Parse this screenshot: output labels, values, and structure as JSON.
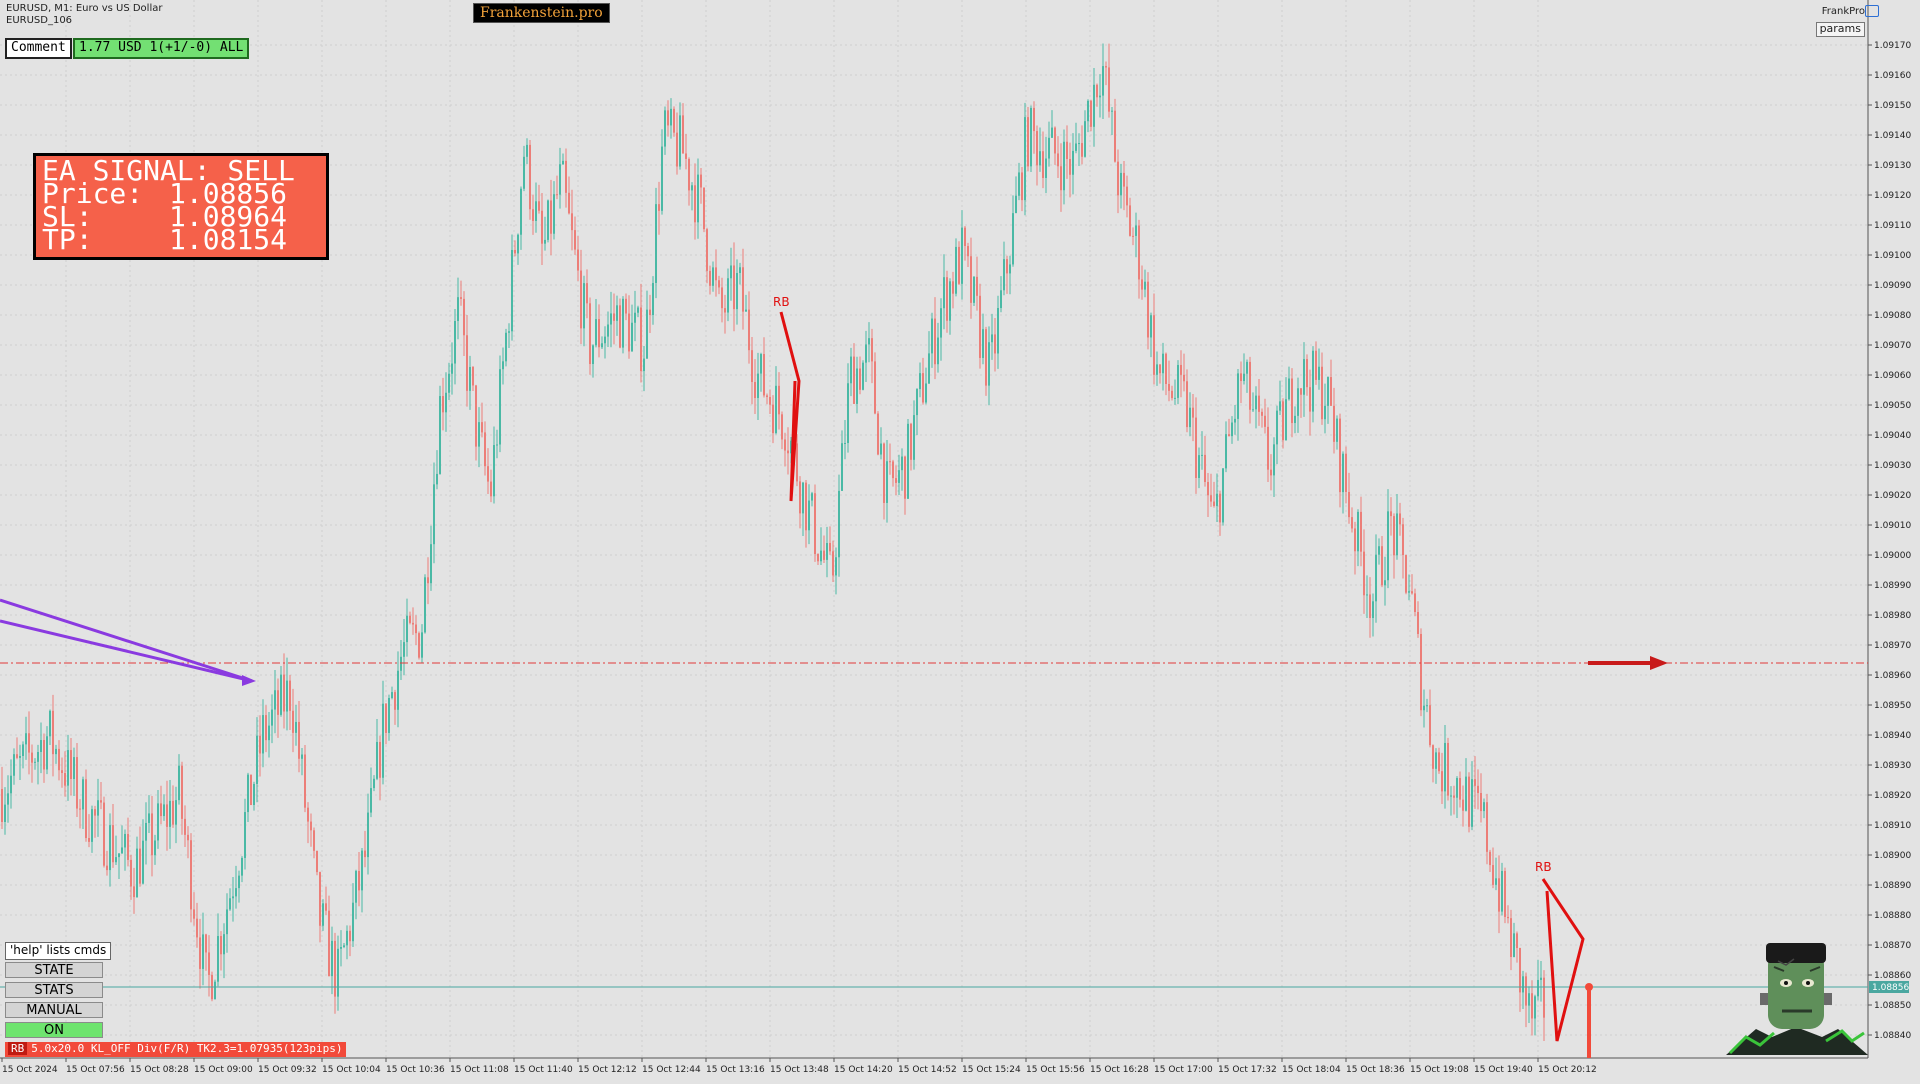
{
  "window": {
    "symbol_line": "EURUSD, M1:  Euro vs US Dollar",
    "sub_line": "EURUSD_106",
    "brand_tag": "Frankenstein.pro",
    "right_brand": "FrankPro",
    "params_label": "params"
  },
  "comment": {
    "label": "Comment",
    "value": "1.77 USD 1(+1/-0) ALL"
  },
  "signal_panel": {
    "title": "EA SIGNAL: SELL",
    "rows": [
      {
        "key": "Price:",
        "value": "1.08856"
      },
      {
        "key": "SL:",
        "value": "1.08964"
      },
      {
        "key": "TP:",
        "value": "1.08154"
      }
    ]
  },
  "buttons": {
    "help": "'help' lists cmds",
    "state": "STATE",
    "stats": "STATS",
    "manual": "MANUAL",
    "on": "ON"
  },
  "status_strip": {
    "tag": "RB",
    "text": "5.0x20.0 KL_OFF Div(F/R) TK2.3=1.07935(123pips)"
  },
  "colors": {
    "bull": "#4ab9a5",
    "bear": "#ec7e78",
    "level_line": "#e03a3a",
    "bid_line": "#4aa7a0",
    "pattern": "#e01010",
    "trend_arrow": "#8a3ae0",
    "signal_bg": "#f5614a"
  },
  "icons": [
    "graduation-cap-icon",
    "frankenstein-mascot-icon",
    "arrow-right-icon",
    "trend-arrow-icon"
  ],
  "chart_data": {
    "type": "candlestick",
    "timeframe": "M1",
    "ylim": [
      1.08835,
      1.09175
    ],
    "price_labels": [
      "1.09170",
      "1.09160",
      "1.09150",
      "1.09140",
      "1.09130",
      "1.09120",
      "1.09110",
      "1.09100",
      "1.09090",
      "1.09080",
      "1.09070",
      "1.09060",
      "1.09050",
      "1.09040",
      "1.09030",
      "1.09020",
      "1.09010",
      "1.09000",
      "1.08990",
      "1.08980",
      "1.08970",
      "1.08960",
      "1.08950",
      "1.08940",
      "1.08930",
      "1.08920",
      "1.08910",
      "1.08900",
      "1.08890",
      "1.08880",
      "1.08870",
      "1.08860",
      "1.08850",
      "1.08840"
    ],
    "time_labels": [
      "15 Oct 2024",
      "15 Oct 07:56",
      "15 Oct 08:28",
      "15 Oct 09:00",
      "15 Oct 09:32",
      "15 Oct 10:04",
      "15 Oct 10:36",
      "15 Oct 11:08",
      "15 Oct 11:40",
      "15 Oct 12:12",
      "15 Oct 12:44",
      "15 Oct 13:16",
      "15 Oct 13:48",
      "15 Oct 14:20",
      "15 Oct 14:52",
      "15 Oct 15:24",
      "15 Oct 15:56",
      "15 Oct 16:28",
      "15 Oct 17:00",
      "15 Oct 17:32",
      "15 Oct 18:04",
      "15 Oct 18:36",
      "15 Oct 19:08",
      "15 Oct 19:40",
      "15 Oct 20:12"
    ],
    "current_price_label": "1.08856",
    "current_price": 1.08856,
    "level_price": 1.08964,
    "pattern_label": "RB",
    "price_path": [
      {
        "t": 0.0,
        "p": 1.08922
      },
      {
        "t": 0.025,
        "p": 1.0894
      },
      {
        "t": 0.045,
        "p": 1.08915
      },
      {
        "t": 0.07,
        "p": 1.08895
      },
      {
        "t": 0.095,
        "p": 1.0892
      },
      {
        "t": 0.11,
        "p": 1.08855
      },
      {
        "t": 0.125,
        "p": 1.08895
      },
      {
        "t": 0.14,
        "p": 1.0894
      },
      {
        "t": 0.155,
        "p": 1.08955
      },
      {
        "t": 0.17,
        "p": 1.0888
      },
      {
        "t": 0.18,
        "p": 1.08858
      },
      {
        "t": 0.195,
        "p": 1.089
      },
      {
        "t": 0.205,
        "p": 1.08945
      },
      {
        "t": 0.215,
        "p": 1.08968
      },
      {
        "t": 0.225,
        "p": 1.08975
      },
      {
        "t": 0.235,
        "p": 1.0905
      },
      {
        "t": 0.245,
        "p": 1.0908
      },
      {
        "t": 0.255,
        "p": 1.0904
      },
      {
        "t": 0.262,
        "p": 1.0902
      },
      {
        "t": 0.27,
        "p": 1.0907
      },
      {
        "t": 0.28,
        "p": 1.09135
      },
      {
        "t": 0.29,
        "p": 1.091
      },
      {
        "t": 0.3,
        "p": 1.09125
      },
      {
        "t": 0.315,
        "p": 1.0907
      },
      {
        "t": 0.33,
        "p": 1.0908
      },
      {
        "t": 0.345,
        "p": 1.0907
      },
      {
        "t": 0.355,
        "p": 1.0914
      },
      {
        "t": 0.365,
        "p": 1.09135
      },
      {
        "t": 0.375,
        "p": 1.09115
      },
      {
        "t": 0.385,
        "p": 1.0908
      },
      {
        "t": 0.395,
        "p": 1.0909
      },
      {
        "t": 0.405,
        "p": 1.0906
      },
      {
        "t": 0.42,
        "p": 1.09045
      },
      {
        "t": 0.43,
        "p": 1.0902
      },
      {
        "t": 0.445,
        "p": 1.0899
      },
      {
        "t": 0.455,
        "p": 1.0906
      },
      {
        "t": 0.465,
        "p": 1.09065
      },
      {
        "t": 0.475,
        "p": 1.0902
      },
      {
        "t": 0.485,
        "p": 1.0903
      },
      {
        "t": 0.495,
        "p": 1.0906
      },
      {
        "t": 0.505,
        "p": 1.09085
      },
      {
        "t": 0.515,
        "p": 1.091
      },
      {
        "t": 0.53,
        "p": 1.0906
      },
      {
        "t": 0.54,
        "p": 1.091
      },
      {
        "t": 0.55,
        "p": 1.0914
      },
      {
        "t": 0.56,
        "p": 1.09135
      },
      {
        "t": 0.575,
        "p": 1.0913
      },
      {
        "t": 0.59,
        "p": 1.09165
      },
      {
        "t": 0.6,
        "p": 1.0912
      },
      {
        "t": 0.61,
        "p": 1.091
      },
      {
        "t": 0.62,
        "p": 1.0906
      },
      {
        "t": 0.635,
        "p": 1.0905
      },
      {
        "t": 0.65,
        "p": 1.0901
      },
      {
        "t": 0.665,
        "p": 1.0906
      },
      {
        "t": 0.68,
        "p": 1.0903
      },
      {
        "t": 0.695,
        "p": 1.0906
      },
      {
        "t": 0.71,
        "p": 1.09055
      },
      {
        "t": 0.725,
        "p": 1.0901
      },
      {
        "t": 0.735,
        "p": 1.08985
      },
      {
        "t": 0.745,
        "p": 1.0901
      },
      {
        "t": 0.755,
        "p": 1.0899
      },
      {
        "t": 0.762,
        "p": 1.08955
      },
      {
        "t": 0.77,
        "p": 1.0893
      },
      {
        "t": 0.78,
        "p": 1.08925
      },
      {
        "t": 0.795,
        "p": 1.0891
      },
      {
        "t": 0.81,
        "p": 1.0887
      },
      {
        "t": 0.82,
        "p": 1.08845
      },
      {
        "t": 0.83,
        "p": 1.08852
      }
    ]
  }
}
